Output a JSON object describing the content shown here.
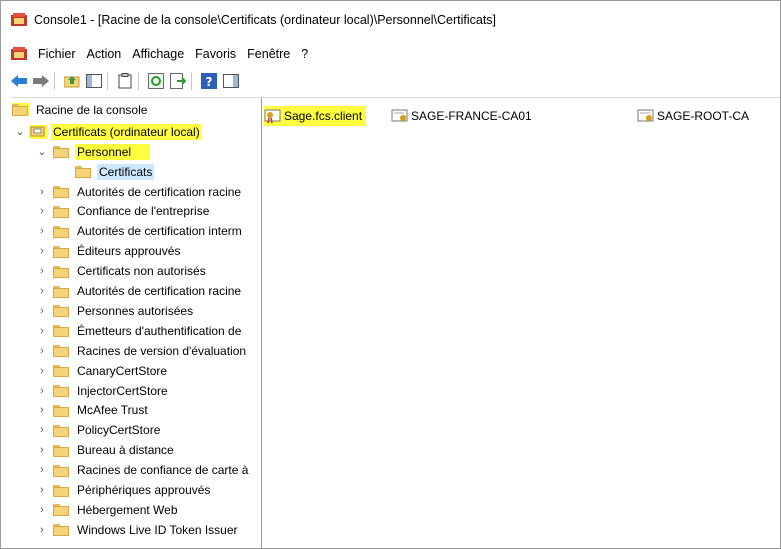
{
  "window": {
    "title": "Console1 - [Racine de la console\\Certificats (ordinateur local)\\Personnel\\Certificats]"
  },
  "menu": [
    "Fichier",
    "Action",
    "Affichage",
    "Favoris",
    "Fenêtre",
    "?"
  ],
  "toolbar": {
    "buttons": [
      "back-arrow-icon",
      "forward-arrow-icon",
      "up-folder-icon",
      "show-hide-tree-icon",
      "properties-icon",
      "refresh-icon",
      "export-list-icon",
      "help-icon",
      "action-pane-icon"
    ]
  },
  "tree": {
    "root": "Racine de la console",
    "certificates_local": "Certificats (ordinateur local)",
    "personal": "Personnel",
    "personal_certs": "Certificats",
    "stores": [
      "Autorités de certification racine",
      "Confiance de l'entreprise",
      "Autorités de certification interm",
      "Éditeurs approuvés",
      "Certificats non autorisés",
      "Autorités de certification racine",
      "Personnes autorisées",
      "Émetteurs d'authentification de",
      "Racines de version d'évaluation",
      "CanaryCertStore",
      "InjectorCertStore",
      "McAfee Trust",
      "PolicyCertStore",
      "Bureau à distance",
      "Racines de confiance de carte à",
      "Périphériques approuvés",
      "Hébergement Web",
      "Windows Live ID Token Issuer"
    ]
  },
  "certificates": [
    "Sage.fcs.client",
    "SAGE-FRANCE-CA01",
    "SAGE-ROOT-CA"
  ],
  "colors": {
    "highlight": "#ffff40",
    "selection": "#cce8ff",
    "folder": "#f5d479"
  }
}
